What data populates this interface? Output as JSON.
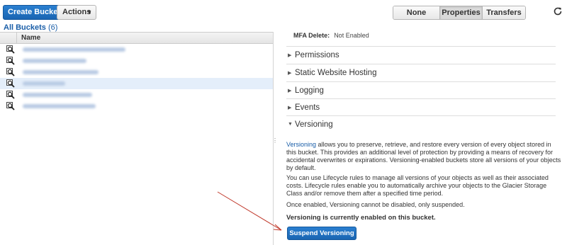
{
  "toolbar": {
    "create_bucket_label": "Create Bucket",
    "actions_label": "Actions",
    "view_tabs": [
      "None",
      "Properties",
      "Transfers"
    ],
    "active_tab": "Properties",
    "accent_color": "#1a65b2"
  },
  "breadcrumb": {
    "label": "All Buckets",
    "count": "(6)"
  },
  "bucket_table": {
    "column_name": "Name",
    "rows": [
      {
        "blurred": true,
        "selected": false
      },
      {
        "blurred": true,
        "selected": false
      },
      {
        "blurred": true,
        "selected": false
      },
      {
        "blurred": true,
        "selected": true
      },
      {
        "blurred": true,
        "selected": false
      },
      {
        "blurred": true,
        "selected": false
      }
    ]
  },
  "properties": {
    "mfa_label": "MFA Delete:",
    "mfa_value": "Not Enabled",
    "sections": [
      "Permissions",
      "Static Website Hosting",
      "Logging",
      "Events",
      "Versioning"
    ],
    "expanded_section": "Versioning",
    "versioning": {
      "p1_link": "Versioning",
      "p1_rest": " allows you to preserve, retrieve, and restore every version of every object stored in this bucket. This provides an additional level of protection by providing a means of recovery for accidental overwrites or expirations. Versioning-enabled buckets store all versions of your objects by default.",
      "p2": "You can use Lifecycle rules to manage all versions of your objects as well as their associated costs. Lifecycle rules enable you to automatically archive your objects to the Glacier Storage Class and/or remove them after a specified time period.",
      "p3": "Once enabled, Versioning cannot be disabled, only suspended.",
      "status": "Versioning is currently enabled on this bucket.",
      "suspend_label": "Suspend Versioning"
    }
  }
}
